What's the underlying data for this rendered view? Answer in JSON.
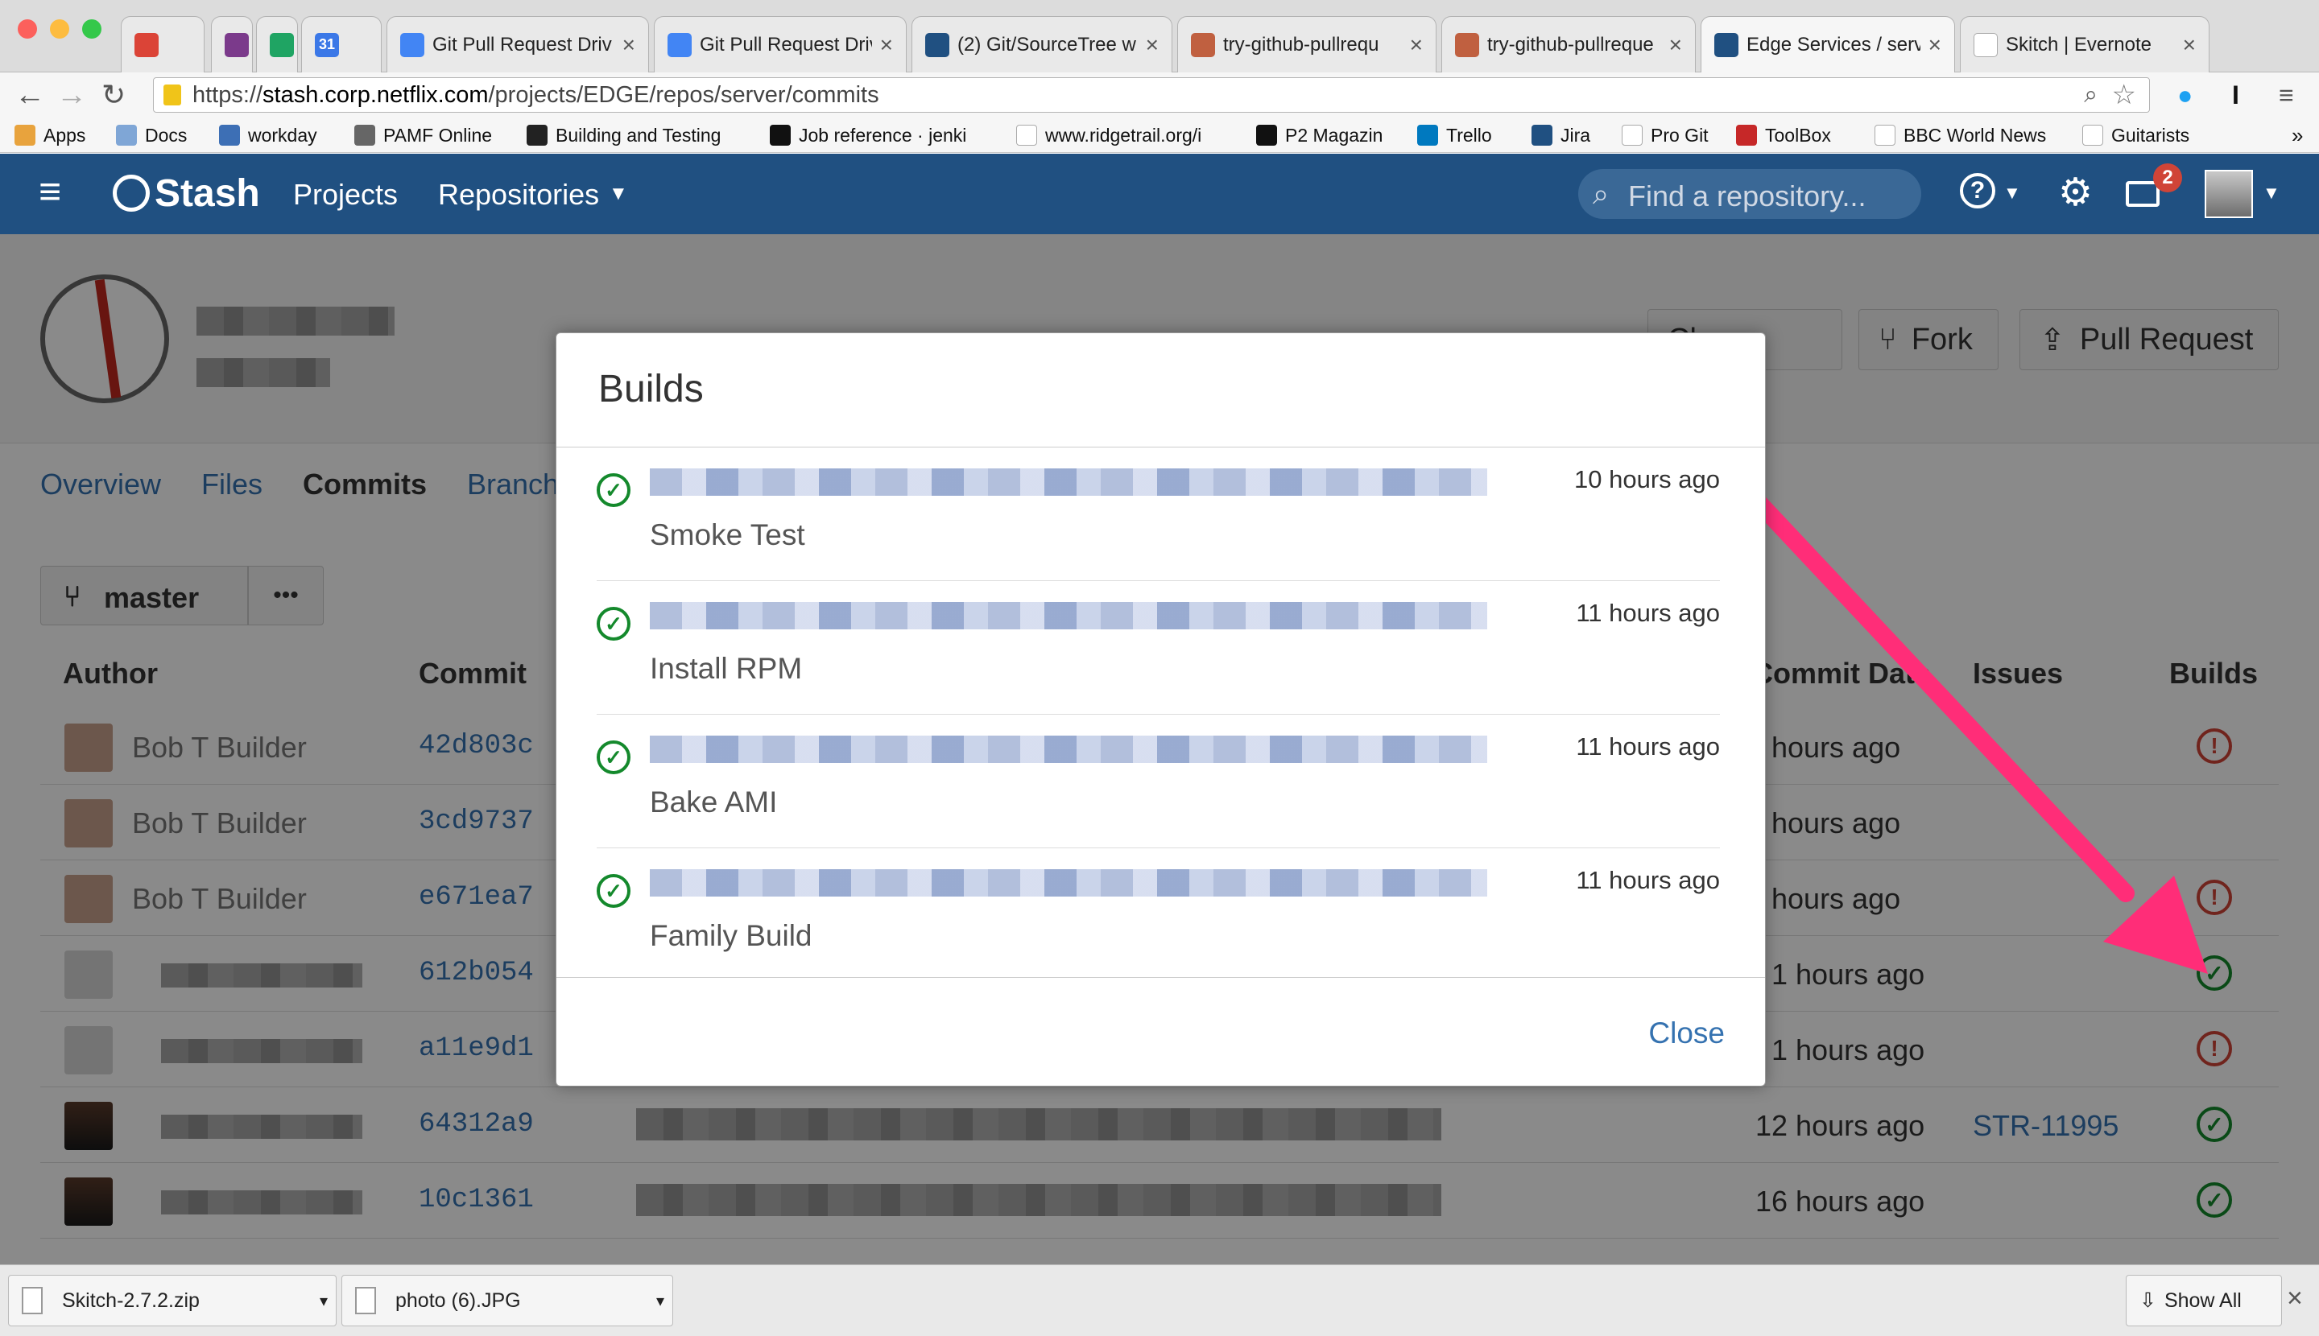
{
  "browser": {
    "tabs": [
      {
        "label": "",
        "icon": "gmail-icon",
        "color": "#db4437"
      },
      {
        "label": "",
        "icon": "trello-icon",
        "color": "#7b3a8b"
      },
      {
        "label": "",
        "icon": "drive-icon",
        "color": "#1fa463"
      },
      {
        "label": "",
        "icon": "calendar-icon",
        "color": "#3b78e7",
        "glyph": "31"
      },
      {
        "label": "Git Pull Request Driv",
        "icon": "docs-icon",
        "color": "#4285f4"
      },
      {
        "label": "Git Pull Request Driv",
        "icon": "docs-icon",
        "color": "#4285f4"
      },
      {
        "label": "(2) Git/SourceTree w",
        "icon": "sourcetree-icon",
        "color": "#205081"
      },
      {
        "label": "try-github-pullrequ",
        "icon": "jenkins-icon",
        "color": "#c06040"
      },
      {
        "label": "try-github-pullreque",
        "icon": "jenkins-icon",
        "color": "#c06040"
      },
      {
        "label": "Edge Services / serv",
        "icon": "stash-icon",
        "color": "#205081"
      },
      {
        "label": "Skitch | Evernote",
        "icon": "page-icon",
        "color": "#ffffff"
      }
    ],
    "url_prefix": "https://",
    "url_host": "stash.corp.netflix.com",
    "url_path": "/projects/EDGE/repos/server/commits",
    "bookmarks": [
      {
        "label": "Apps",
        "icon": "apps-icon"
      },
      {
        "label": "Docs",
        "icon": "folder-icon"
      },
      {
        "label": "workday",
        "icon": "workday-icon"
      },
      {
        "label": "PAMF Online",
        "icon": "pamf-icon"
      },
      {
        "label": "Building and Testing",
        "icon": "jenkins-icon"
      },
      {
        "label": "Job reference · jenki",
        "icon": "github-icon"
      },
      {
        "label": "www.ridgetrail.org/i",
        "icon": "page-icon"
      },
      {
        "label": "P2 Magazin",
        "icon": "p2-icon"
      },
      {
        "label": "Trello",
        "icon": "trello-icon"
      },
      {
        "label": "Jira",
        "icon": "jira-icon"
      },
      {
        "label": "Pro Git",
        "icon": "page-icon"
      },
      {
        "label": "ToolBox",
        "icon": "toolbox-icon"
      },
      {
        "label": "BBC World News",
        "icon": "page-icon"
      },
      {
        "label": "Guitarists",
        "icon": "page-icon"
      }
    ],
    "bookmarks_overflow": "»"
  },
  "stash": {
    "logo": "Stash",
    "nav_projects": "Projects",
    "nav_repositories": "Repositories",
    "search_placeholder": "Find a repository...",
    "notification_count": "2",
    "buttons": {
      "clone": "Clone",
      "fork": "Fork",
      "pull_request": "Pull Request"
    },
    "tabs": [
      "Overview",
      "Files",
      "Commits",
      "Branch"
    ],
    "branch": "master",
    "more": "•••",
    "columns": {
      "author": "Author",
      "commit": "Commit",
      "date": "Commit Date",
      "issues": "Issues",
      "builds": "Builds"
    },
    "rows": [
      {
        "author": "Bob T Builder",
        "commit": "42d803c",
        "date": "hours ago",
        "issue": "",
        "build": "err"
      },
      {
        "author": "Bob T Builder",
        "commit": "3cd9737",
        "date": "hours ago",
        "issue": "",
        "build": "none"
      },
      {
        "author": "Bob T Builder",
        "commit": "e671ea7",
        "date": "hours ago",
        "issue": "",
        "build": "err"
      },
      {
        "author": "",
        "commit": "612b054",
        "date": "1 hours ago",
        "issue": "",
        "build": "ok"
      },
      {
        "author": "",
        "commit": "a11e9d1",
        "date": "1 hours ago",
        "issue": "",
        "build": "err"
      },
      {
        "author": "",
        "commit": "64312a9",
        "date": "12 hours ago",
        "issue": "STR-11995",
        "build": "ok"
      },
      {
        "author": "",
        "commit": "10c1361",
        "date": "16 hours ago",
        "issue": "",
        "build": "ok"
      }
    ]
  },
  "modal": {
    "title": "Builds",
    "builds": [
      {
        "type": "Smoke Test",
        "time": "10 hours ago"
      },
      {
        "type": "Install RPM",
        "time": "11 hours ago"
      },
      {
        "type": "Bake AMI",
        "time": "11 hours ago"
      },
      {
        "type": "Family Build",
        "time": "11 hours ago"
      }
    ],
    "close": "Close"
  },
  "downloads": {
    "items": [
      {
        "name": "Skitch-2.7.2.zip"
      },
      {
        "name": "photo (6).JPG"
      }
    ],
    "show_all": "Show All",
    "close": "×"
  },
  "colors": {
    "stash_blue": "#205081",
    "link": "#3572b0",
    "success": "#14892c",
    "error": "#d04437",
    "arrow": "#ff2d78"
  }
}
